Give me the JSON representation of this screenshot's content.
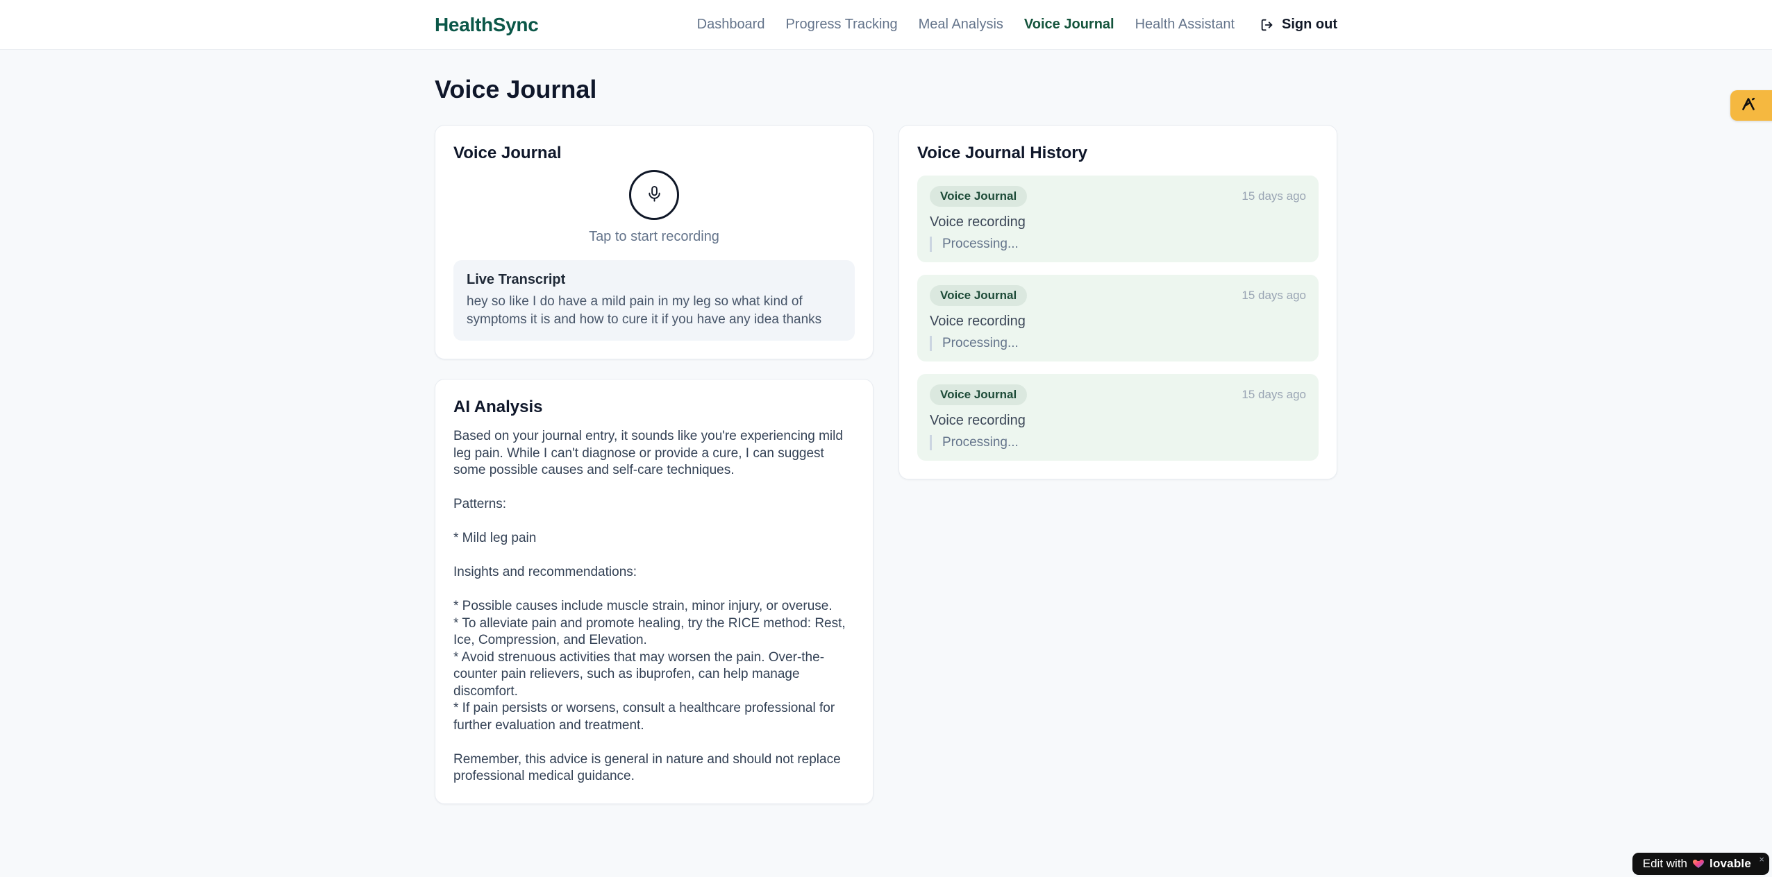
{
  "brand": {
    "name": "HealthSync",
    "color": "#0b5748"
  },
  "nav": {
    "items": [
      {
        "label": "Dashboard",
        "active": false
      },
      {
        "label": "Progress Tracking",
        "active": false
      },
      {
        "label": "Meal Analysis",
        "active": false
      },
      {
        "label": "Voice Journal",
        "active": true
      },
      {
        "label": "Health Assistant",
        "active": false
      }
    ],
    "sign_out_label": "Sign out",
    "active_color": "#14543c"
  },
  "page": {
    "title": "Voice Journal"
  },
  "recorder_card": {
    "title": "Voice Journal",
    "mic_icon": "microphone-icon",
    "tap_hint": "Tap to start recording",
    "transcript_title": "Live Transcript",
    "transcript_text": "hey so like I do have a mild pain in my leg so what kind of symptoms it is and how to cure it if you have any idea thanks"
  },
  "analysis_card": {
    "title": "AI Analysis",
    "body": "Based on your journal entry, it sounds like you're experiencing mild leg pain. While I can't diagnose or provide a cure, I can suggest some possible causes and self-care techniques.\n\nPatterns:\n\n* Mild leg pain\n\nInsights and recommendations:\n\n* Possible causes include muscle strain, minor injury, or overuse.\n* To alleviate pain and promote healing, try the RICE method: Rest, Ice, Compression, and Elevation.\n* Avoid strenuous activities that may worsen the pain. Over-the-counter pain relievers, such as ibuprofen, can help manage discomfort.\n* If pain persists or worsens, consult a healthcare professional for further evaluation and treatment.\n\nRemember, this advice is general in nature and should not replace professional medical guidance."
  },
  "history_card": {
    "title": "Voice Journal History",
    "entry_bg": "#edf6ef",
    "badge_bg": "#dbe8df",
    "badge_text_color": "#1d4b38",
    "entries": [
      {
        "badge": "Voice Journal",
        "time": "15 days ago",
        "title": "Voice recording",
        "status": "Processing..."
      },
      {
        "badge": "Voice Journal",
        "time": "15 days ago",
        "title": "Voice recording",
        "status": "Processing..."
      },
      {
        "badge": "Voice Journal",
        "time": "15 days ago",
        "title": "Voice recording",
        "status": "Processing..."
      }
    ]
  },
  "overlays": {
    "amber_badge": {
      "color": "#f5b840",
      "icon": "peak-logo-icon"
    },
    "lovable_badge": {
      "prefix": "Edit with",
      "heart_icon": "gradient-heart-icon",
      "brand": "lovable",
      "close": "×"
    }
  }
}
